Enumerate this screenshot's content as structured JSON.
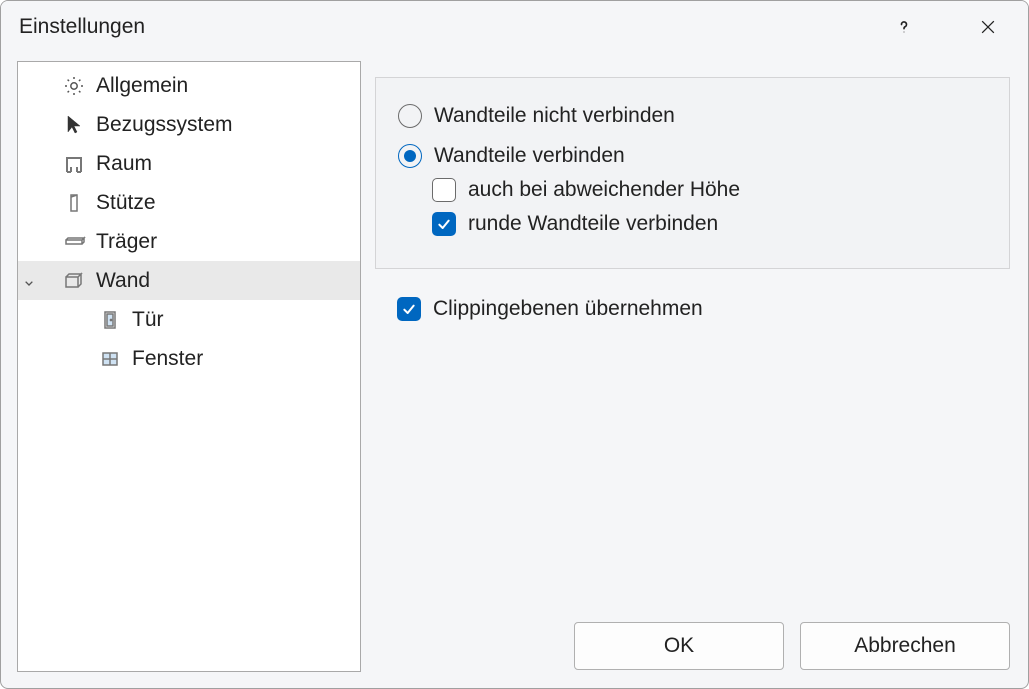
{
  "title": "Einstellungen",
  "sidebar": {
    "items": [
      {
        "label": "Allgemein",
        "icon": "gear-icon",
        "depth": 1,
        "selected": false,
        "expandable": false
      },
      {
        "label": "Bezugssystem",
        "icon": "cursor-icon",
        "depth": 1,
        "selected": false,
        "expandable": false
      },
      {
        "label": "Raum",
        "icon": "room-icon",
        "depth": 1,
        "selected": false,
        "expandable": false
      },
      {
        "label": "Stütze",
        "icon": "column-icon",
        "depth": 1,
        "selected": false,
        "expandable": false
      },
      {
        "label": "Träger",
        "icon": "beam-icon",
        "depth": 1,
        "selected": false,
        "expandable": false
      },
      {
        "label": "Wand",
        "icon": "wall-icon",
        "depth": 1,
        "selected": true,
        "expandable": true,
        "expanded": true
      },
      {
        "label": "Tür",
        "icon": "door-icon",
        "depth": 2,
        "selected": false,
        "expandable": false
      },
      {
        "label": "Fenster",
        "icon": "window-icon",
        "depth": 2,
        "selected": false,
        "expandable": false
      }
    ]
  },
  "options": {
    "radio_not_connect": {
      "label": "Wandteile nicht verbinden",
      "checked": false
    },
    "radio_connect": {
      "label": "Wandteile verbinden",
      "checked": true
    },
    "check_diff_height": {
      "label": "auch bei abweichender Höhe",
      "checked": false
    },
    "check_round": {
      "label": "runde Wandteile verbinden",
      "checked": true
    },
    "check_clipping": {
      "label": "Clippingebenen übernehmen",
      "checked": true
    }
  },
  "buttons": {
    "ok": "OK",
    "cancel": "Abbrechen"
  }
}
